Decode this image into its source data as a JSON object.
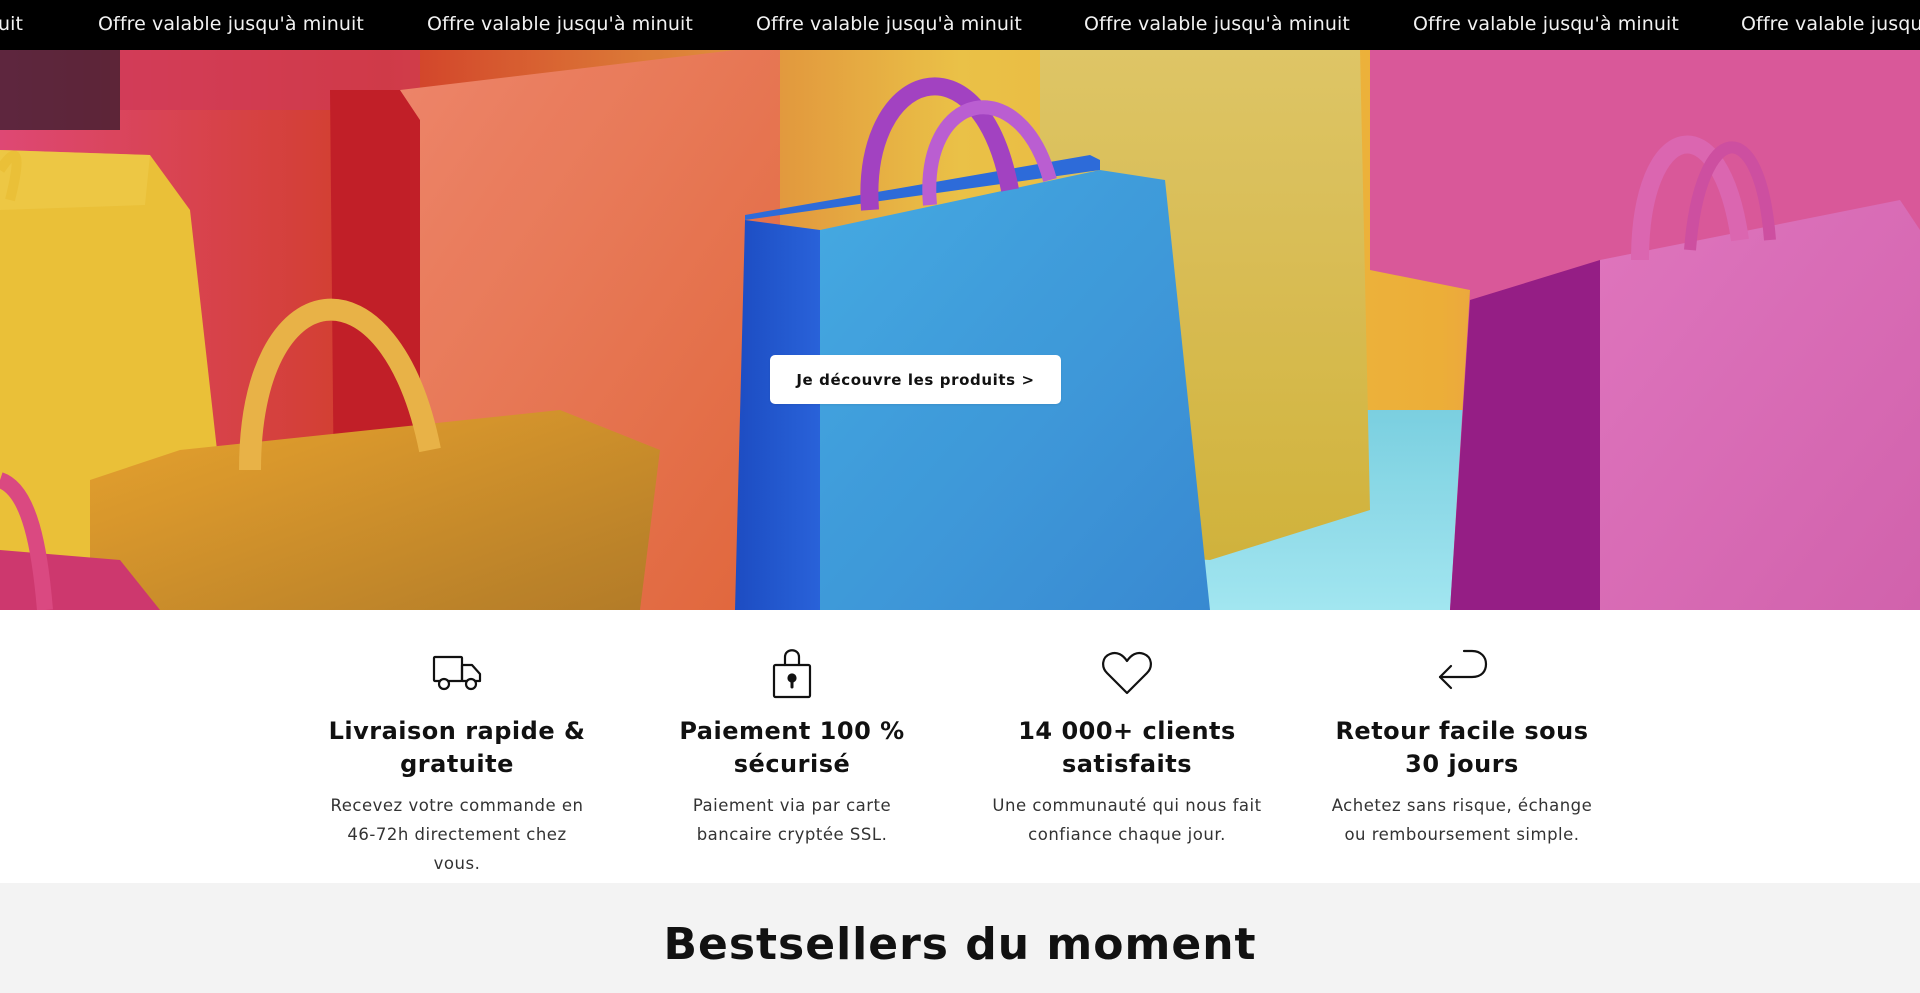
{
  "announcement": {
    "text": "Offre valable jusqu'à minuit",
    "fragment": "uit",
    "partial": "Offre valable jusqu'à"
  },
  "hero": {
    "cta_label": "Je découvre les produits >"
  },
  "features": [
    {
      "icon": "truck-icon",
      "title": "Livraison rapide & gratuite",
      "text": "Recevez votre commande en 46-72h directement chez vous."
    },
    {
      "icon": "padlock-icon",
      "title": "Paiement 100 % sécurisé",
      "text": "Paiement via par carte bancaire cryptée SSL."
    },
    {
      "icon": "heart-icon",
      "title": "14 000+ clients satisfaits",
      "text": "Une communauté qui nous fait confiance chaque jour."
    },
    {
      "icon": "return-arrow-icon",
      "title": "Retour facile sous 30 jours",
      "text": "Achetez sans risque, échange ou remboursement simple."
    }
  ],
  "bestsellers": {
    "title": "Bestsellers du moment"
  },
  "colors": {
    "announcement_bg": "#000000",
    "announcement_text": "#f2f2f2",
    "section_bg": "#f3f3f3"
  }
}
